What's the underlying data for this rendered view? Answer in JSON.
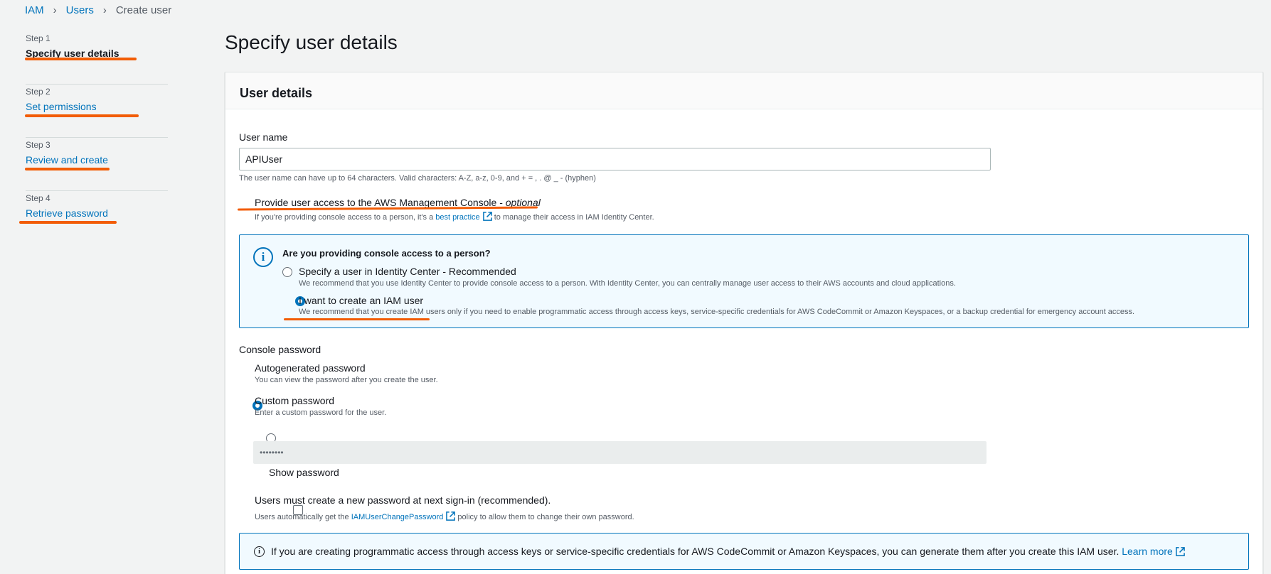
{
  "breadcrumb": {
    "iam": "IAM",
    "users": "Users",
    "current": "Create user"
  },
  "steps": [
    {
      "num": "Step 1",
      "label": "Specify user details"
    },
    {
      "num": "Step 2",
      "label": "Set permissions"
    },
    {
      "num": "Step 3",
      "label": "Review and create"
    },
    {
      "num": "Step 4",
      "label": "Retrieve password"
    }
  ],
  "page_title": "Specify user details",
  "panel_title": "User details",
  "user_name": {
    "label": "User name",
    "value": "APIUser",
    "hint": "The user name can have up to 64 characters. Valid characters: A-Z, a-z, 0-9, and + = , . @ _ - (hyphen)"
  },
  "console_access": {
    "label": "Provide user access to the AWS Management Console - ",
    "optional": "optional",
    "hint_pre": "If you're providing console access to a person, it's a ",
    "hint_link": "best practice",
    "hint_post": " to manage their access in IAM Identity Center."
  },
  "person_box": {
    "title": "Are you providing console access to a person?",
    "opt1_label": "Specify a user in Identity Center - Recommended",
    "opt1_desc": "We recommend that you use Identity Center to provide console access to a person. With Identity Center, you can centrally manage user access to their AWS accounts and cloud applications.",
    "opt2_label": "I want to create an IAM user",
    "opt2_desc": "We recommend that you create IAM users only if you need to enable programmatic access through access keys, service-specific credentials for AWS CodeCommit or Amazon Keyspaces, or a backup credential for emergency account access."
  },
  "console_password": {
    "label": "Console password",
    "auto_label": "Autogenerated password",
    "auto_desc": "You can view the password after you create the user.",
    "custom_label": "Custom password",
    "custom_desc": "Enter a custom password for the user.",
    "masked_value": "••••••••",
    "show_label": "Show password"
  },
  "reset": {
    "label": "Users must create a new password at next sign-in (recommended).",
    "hint_pre": "Users automatically get the ",
    "hint_link": "IAMUserChangePassword",
    "hint_post": " policy to allow them to change their own password."
  },
  "bottom_info": {
    "text": "If you are creating programmatic access through access keys or service-specific credentials for AWS CodeCommit or Amazon Keyspaces, you can generate them after you create this IAM user. ",
    "link": "Learn more"
  },
  "colors": {
    "link": "#0073bb",
    "annotation": "#f25c05",
    "info_bg": "#f1faff"
  }
}
